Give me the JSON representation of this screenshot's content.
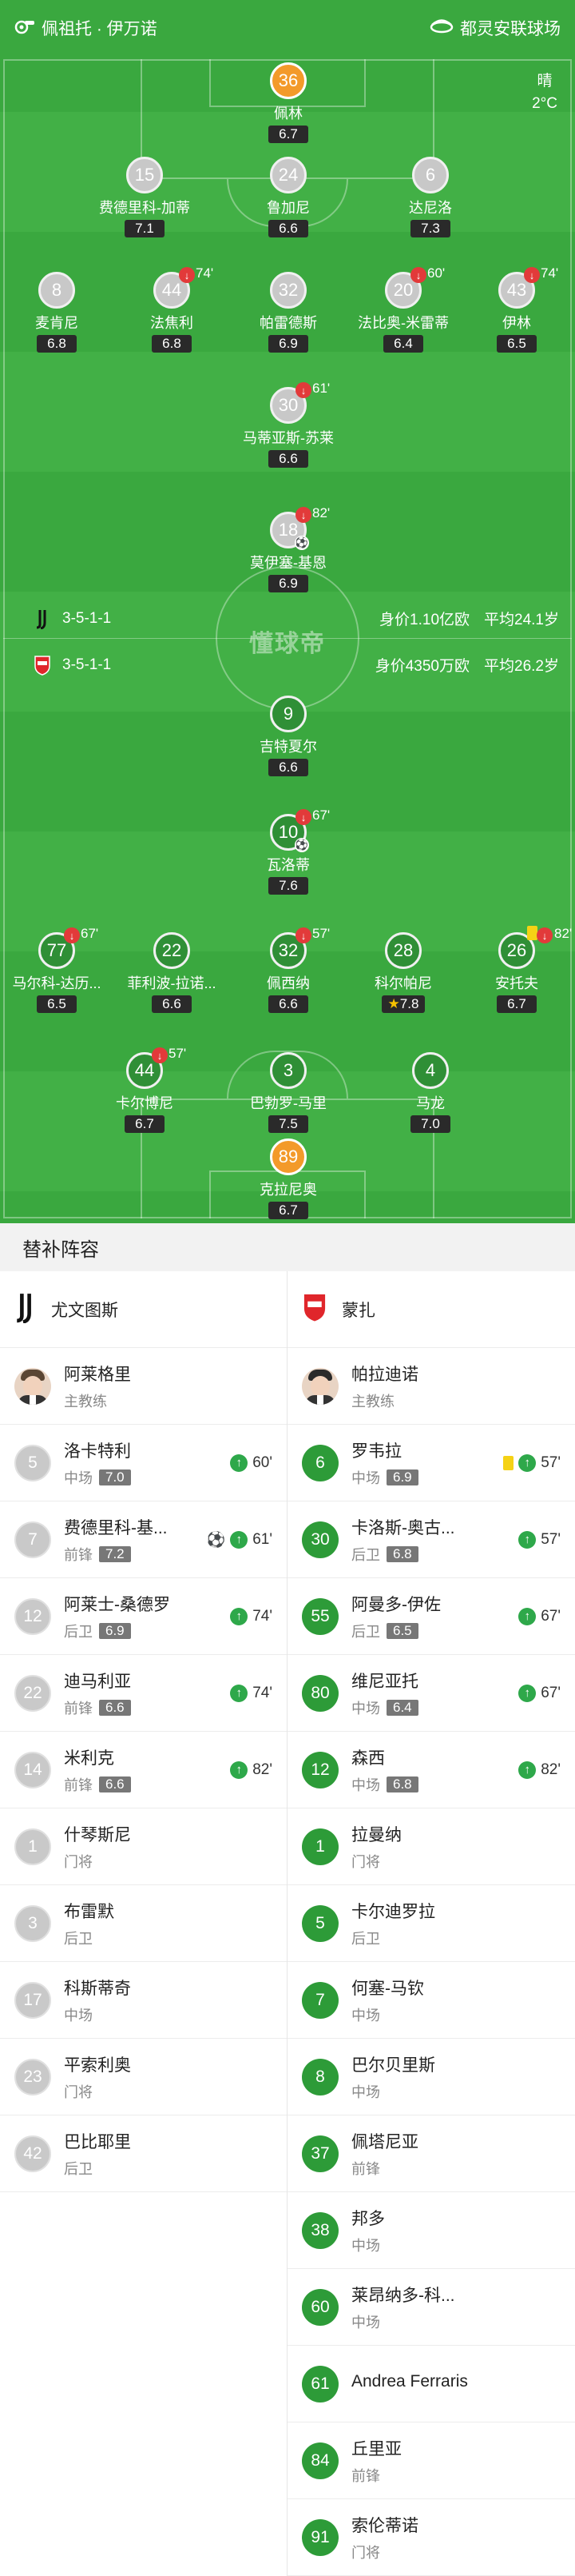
{
  "header": {
    "home_team": "佩祖托 · 伊万诺",
    "stadium": "都灵安联球场",
    "weather": "晴",
    "temperature": "2°C"
  },
  "formations": {
    "home": {
      "formation": "3-5-1-1",
      "value": "身价1.10亿欧",
      "age": "平均24.1岁"
    },
    "away": {
      "formation": "3-5-1-1",
      "value": "身价4350万欧",
      "age": "平均26.2岁"
    }
  },
  "watermark": "懂球帝",
  "home_players": [
    {
      "num": "36",
      "name": "佩林",
      "rating": "6.7"
    },
    {
      "num": "15",
      "name": "费德里科-加蒂",
      "rating": "7.1"
    },
    {
      "num": "24",
      "name": "鲁加尼",
      "rating": "6.6"
    },
    {
      "num": "6",
      "name": "达尼洛",
      "rating": "7.3"
    },
    {
      "num": "8",
      "name": "麦肯尼",
      "rating": "6.8"
    },
    {
      "num": "44",
      "name": "法焦利",
      "rating": "6.8",
      "sub": "74'"
    },
    {
      "num": "32",
      "name": "帕雷德斯",
      "rating": "6.9"
    },
    {
      "num": "20",
      "name": "法比奥-米雷蒂",
      "rating": "6.4",
      "sub": "60'"
    },
    {
      "num": "43",
      "name": "伊林",
      "rating": "6.5",
      "sub": "74'"
    },
    {
      "num": "30",
      "name": "马蒂亚斯-苏莱",
      "rating": "6.6",
      "sub": "61'"
    },
    {
      "num": "18",
      "name": "莫伊塞-基恩",
      "rating": "6.9",
      "sub": "82'"
    }
  ],
  "away_players": [
    {
      "num": "9",
      "name": "吉特夏尔",
      "rating": "6.6"
    },
    {
      "num": "10",
      "name": "瓦洛蒂",
      "rating": "7.6",
      "sub": "67'"
    },
    {
      "num": "77",
      "name": "马尔科-达历...",
      "rating": "6.5",
      "sub": "67'"
    },
    {
      "num": "22",
      "name": "菲利波-拉诺...",
      "rating": "6.6"
    },
    {
      "num": "32",
      "name": "佩西纳",
      "rating": "6.6",
      "sub": "57'"
    },
    {
      "num": "28",
      "name": "科尔帕尼",
      "rating": "7.8"
    },
    {
      "num": "26",
      "name": "安托夫",
      "rating": "6.7",
      "sub": "82'"
    },
    {
      "num": "44",
      "name": "卡尔博尼",
      "rating": "6.7",
      "sub": "57'"
    },
    {
      "num": "3",
      "name": "巴勃罗-马里",
      "rating": "7.5"
    },
    {
      "num": "4",
      "name": "马龙",
      "rating": "7.0"
    },
    {
      "num": "89",
      "name": "克拉尼奥",
      "rating": "6.7"
    }
  ],
  "subs": {
    "title": "替补阵容",
    "home_team": "尤文图斯",
    "away_team": "蒙扎",
    "home_coach": {
      "name": "阿莱格里",
      "role": "主教练"
    },
    "away_coach": {
      "name": "帕拉迪诺",
      "role": "主教练"
    },
    "home": [
      {
        "num": "5",
        "name": "洛卡特利",
        "pos": "中场",
        "rating": "7.0",
        "minute": "60'"
      },
      {
        "num": "7",
        "name": "费德里科-基...",
        "pos": "前锋",
        "rating": "7.2",
        "minute": "61'",
        "goal": true
      },
      {
        "num": "12",
        "name": "阿莱士-桑德罗",
        "pos": "后卫",
        "rating": "6.9",
        "minute": "74'"
      },
      {
        "num": "22",
        "name": "迪马利亚",
        "pos": "前锋",
        "rating": "6.6",
        "minute": "74'"
      },
      {
        "num": "14",
        "name": "米利克",
        "pos": "前锋",
        "rating": "6.6",
        "minute": "82'"
      },
      {
        "num": "1",
        "name": "什琴斯尼",
        "pos": "门将"
      },
      {
        "num": "3",
        "name": "布雷默",
        "pos": "后卫"
      },
      {
        "num": "17",
        "name": "科斯蒂奇",
        "pos": "中场"
      },
      {
        "num": "23",
        "name": "平索利奥",
        "pos": "门将"
      },
      {
        "num": "42",
        "name": "巴比耶里",
        "pos": "后卫"
      }
    ],
    "away": [
      {
        "num": "6",
        "name": "罗韦拉",
        "pos": "中场",
        "rating": "6.9",
        "minute": "57'",
        "yellow": true
      },
      {
        "num": "30",
        "name": "卡洛斯-奥古...",
        "pos": "后卫",
        "rating": "6.8",
        "minute": "57'"
      },
      {
        "num": "55",
        "name": "阿曼多-伊佐",
        "pos": "后卫",
        "rating": "6.5",
        "minute": "67'"
      },
      {
        "num": "80",
        "name": "维尼亚托",
        "pos": "中场",
        "rating": "6.4",
        "minute": "67'"
      },
      {
        "num": "12",
        "name": "森西",
        "pos": "中场",
        "rating": "6.8",
        "minute": "82'"
      },
      {
        "num": "1",
        "name": "拉曼纳",
        "pos": "门将"
      },
      {
        "num": "5",
        "name": "卡尔迪罗拉",
        "pos": "后卫"
      },
      {
        "num": "7",
        "name": "何塞-马钦",
        "pos": "中场"
      },
      {
        "num": "8",
        "name": "巴尔贝里斯",
        "pos": "中场"
      },
      {
        "num": "37",
        "name": "佩塔尼亚",
        "pos": "前锋"
      },
      {
        "num": "38",
        "name": "邦多",
        "pos": "中场"
      },
      {
        "num": "60",
        "name": "莱昂纳多-科...",
        "pos": "中场"
      },
      {
        "num": "61",
        "name": "Andrea Ferraris",
        "pos": ""
      },
      {
        "num": "84",
        "name": "丘里亚",
        "pos": "前锋"
      },
      {
        "num": "91",
        "name": "索伦蒂诺",
        "pos": "门将"
      }
    ]
  },
  "colors": {
    "pitch": "#3aa83f",
    "home_circle": "#c9c9c9",
    "away_circle": "#2d9b38",
    "gk": "#f39a2a",
    "sub_red": "#e23a3a"
  }
}
